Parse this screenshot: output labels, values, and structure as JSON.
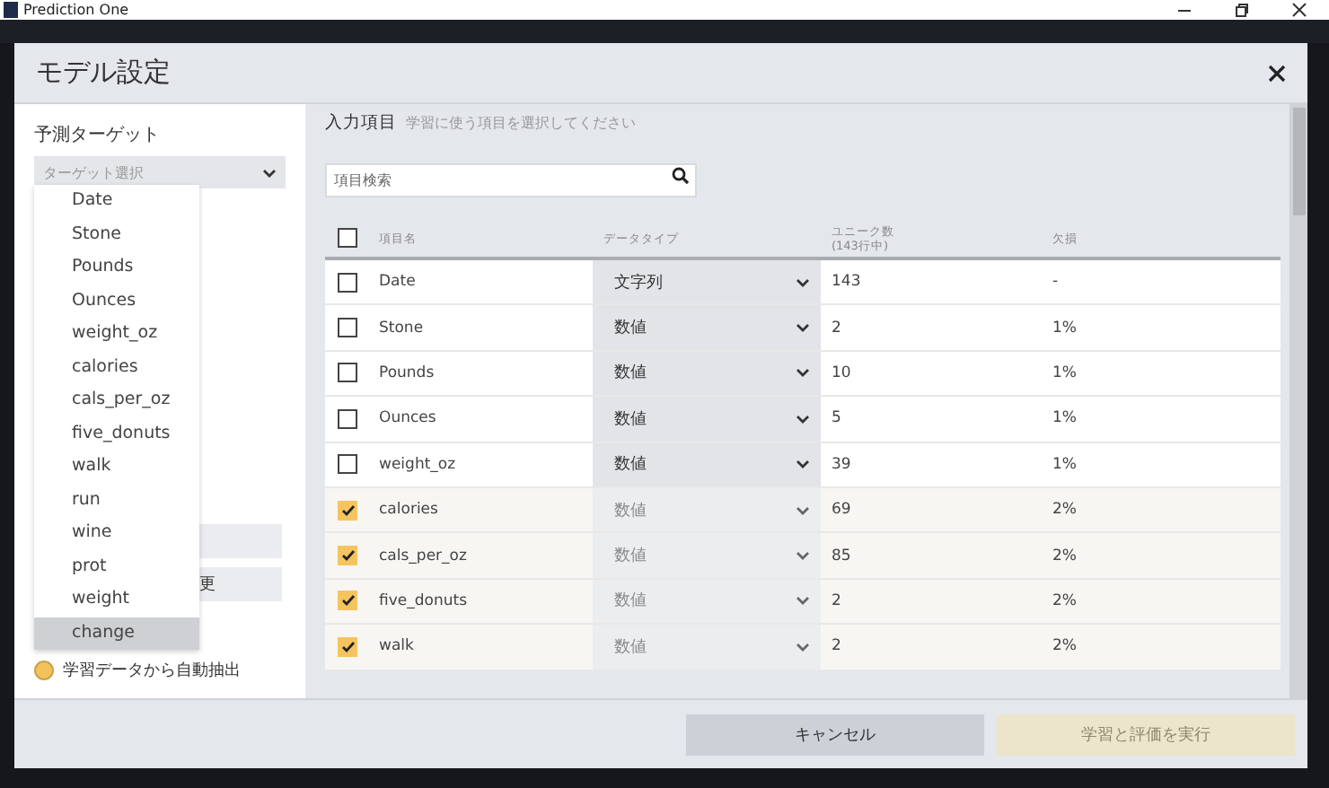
{
  "app": {
    "title": "Prediction One"
  },
  "dialog": {
    "title": "モデル設定"
  },
  "target": {
    "label": "予測ターゲット",
    "placeholder": "ターゲット選択",
    "options": [
      {
        "label": "Date",
        "selected": false
      },
      {
        "label": "Stone",
        "selected": false
      },
      {
        "label": "Pounds",
        "selected": false
      },
      {
        "label": "Ounces",
        "selected": false
      },
      {
        "label": "weight_oz",
        "selected": false
      },
      {
        "label": "calories",
        "selected": false
      },
      {
        "label": "cals_per_oz",
        "selected": false
      },
      {
        "label": "five_donuts",
        "selected": false
      },
      {
        "label": "walk",
        "selected": false
      },
      {
        "label": "run",
        "selected": false
      },
      {
        "label": "wine",
        "selected": false
      },
      {
        "label": "prot",
        "selected": false
      },
      {
        "label": "weight",
        "selected": false
      },
      {
        "label": "change",
        "selected": true
      }
    ]
  },
  "behind": {
    "button_text": "更",
    "radio": {
      "label": "学習データから自動抽出",
      "selected": true
    }
  },
  "inputs": {
    "title": "入力項目",
    "hint": "学習に使う項目を選択してください",
    "search_placeholder": "項目検索",
    "columns": [
      "項目名",
      "データタイプ",
      "ユニーク数\n(143行中)",
      "欠損"
    ],
    "all_checked": false,
    "rows": [
      {
        "name": "Date",
        "type": "文字列",
        "unique": "143",
        "missing": "-",
        "checked": false
      },
      {
        "name": "Stone",
        "type": "数値",
        "unique": "2",
        "missing": "1%",
        "checked": false
      },
      {
        "name": "Pounds",
        "type": "数値",
        "unique": "10",
        "missing": "1%",
        "checked": false
      },
      {
        "name": "Ounces",
        "type": "数値",
        "unique": "5",
        "missing": "1%",
        "checked": false
      },
      {
        "name": "weight_oz",
        "type": "数値",
        "unique": "39",
        "missing": "1%",
        "checked": false
      },
      {
        "name": "calories",
        "type": "数値",
        "unique": "69",
        "missing": "2%",
        "checked": true
      },
      {
        "name": "cals_per_oz",
        "type": "数値",
        "unique": "85",
        "missing": "2%",
        "checked": true
      },
      {
        "name": "five_donuts",
        "type": "数値",
        "unique": "2",
        "missing": "2%",
        "checked": true
      },
      {
        "name": "walk",
        "type": "数値",
        "unique": "2",
        "missing": "2%",
        "checked": true
      }
    ]
  },
  "buttons": [
    {
      "label": "キャンセル",
      "disabled": false
    },
    {
      "label": "学習と評価を実行",
      "disabled": true
    }
  ]
}
